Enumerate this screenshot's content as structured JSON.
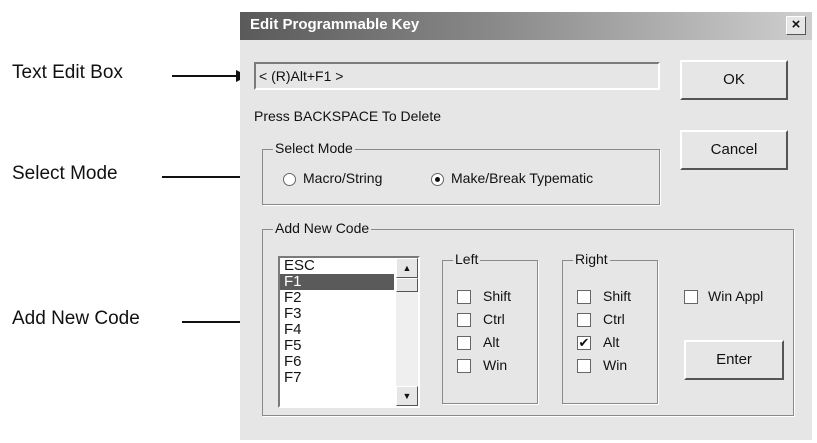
{
  "callouts": {
    "text_edit_box": "Text Edit Box",
    "select_mode": "Select Mode",
    "add_new_code": "Add New Code"
  },
  "dialog": {
    "title": "Edit Programmable Key",
    "close_glyph": "×",
    "text_edit_value": "< (R)Alt+F1 >",
    "hint": "Press BACKSPACE To Delete",
    "ok_label": "OK",
    "cancel_label": "Cancel",
    "enter_label": "Enter"
  },
  "select_mode": {
    "legend": "Select Mode",
    "options": [
      {
        "label": "Macro/String",
        "selected": false
      },
      {
        "label": "Make/Break Typematic",
        "selected": true
      }
    ]
  },
  "add_new_code": {
    "legend": "Add New Code",
    "codes": [
      "ESC",
      "F1",
      "F2",
      "F3",
      "F4",
      "F5",
      "F6",
      "F7"
    ],
    "selected_code": "F1",
    "left": {
      "legend": "Left",
      "keys": [
        {
          "label": "Shift",
          "checked": false
        },
        {
          "label": "Ctrl",
          "checked": false
        },
        {
          "label": "Alt",
          "checked": false
        },
        {
          "label": "Win",
          "checked": false
        }
      ]
    },
    "right": {
      "legend": "Right",
      "keys": [
        {
          "label": "Shift",
          "checked": false
        },
        {
          "label": "Ctrl",
          "checked": false
        },
        {
          "label": "Alt",
          "checked": true
        },
        {
          "label": "Win",
          "checked": false
        }
      ]
    },
    "win_appl": {
      "label": "Win Appl",
      "checked": false
    },
    "check_glyph": "✔",
    "scroll_up_glyph": "▲",
    "scroll_down_glyph": "▼"
  }
}
